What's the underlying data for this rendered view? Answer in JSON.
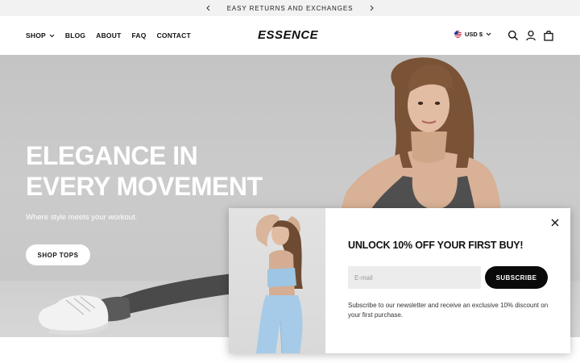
{
  "announcement": {
    "text": "EASY RETURNS AND EXCHANGES",
    "prev_icon": "chevron-left-icon",
    "next_icon": "chevron-right-icon"
  },
  "header": {
    "nav": [
      {
        "label": "SHOP",
        "has_dropdown": true
      },
      {
        "label": "BLOG"
      },
      {
        "label": "ABOUT"
      },
      {
        "label": "FAQ"
      },
      {
        "label": "CONTACT"
      }
    ],
    "logo": "ESSENCE",
    "currency": "USD $",
    "icons": [
      "search-icon",
      "account-icon",
      "cart-icon"
    ]
  },
  "hero": {
    "title_line1": "ELEGANCE IN",
    "title_line2": "EVERY MOVEMENT",
    "subtitle": "Where style meets your workout.",
    "cta": "SHOP TOPS"
  },
  "popup": {
    "title": "UNLOCK 10% OFF YOUR FIRST BUY!",
    "email_placeholder": "E-mail",
    "email_value": "",
    "subscribe_label": "SUBSCRIBE",
    "note": "Subscribe to our newsletter and receive an exclusive 10% discount on your first purchase."
  },
  "colors": {
    "accent": "#0a0a0a",
    "announcement_bg": "#f2f2f2",
    "hero_bg": "#c8c8c8",
    "input_bg": "#ececec"
  }
}
